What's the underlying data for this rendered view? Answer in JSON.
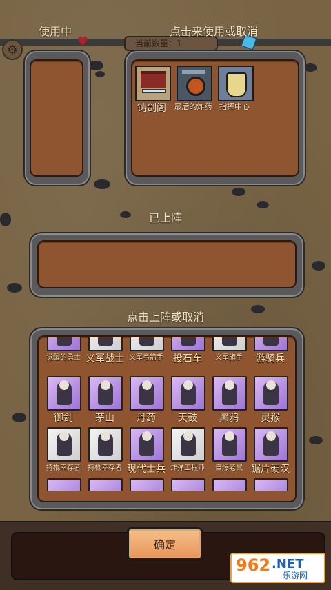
{
  "header": {
    "in_use_label": "使用中",
    "click_use_label": "点击来使用或取消",
    "tab_text": "当前数量：1"
  },
  "buildings": [
    {
      "name": "铸剑阁",
      "icon": "forge-icon",
      "color": "#b9a37a"
    },
    {
      "name": "最后的炸药",
      "icon": "bomb-icon",
      "color": "#4a5662"
    },
    {
      "name": "指挥中心",
      "icon": "command-emblem-icon",
      "color": "#6f7f9a"
    }
  ],
  "deployed_label": "已上阵",
  "units_label": "点击上阵或取消",
  "units": [
    {
      "name": "觉醒的勇士",
      "bg": "purple",
      "small": true
    },
    {
      "name": "义军战士",
      "bg": "white",
      "small": false
    },
    {
      "name": "义军弓箭手",
      "bg": "white",
      "small": true
    },
    {
      "name": "投石车",
      "bg": "purple",
      "small": false
    },
    {
      "name": "义军旗手",
      "bg": "white",
      "small": true
    },
    {
      "name": "游骑兵",
      "bg": "purple",
      "small": false
    },
    {
      "name": "御剑",
      "bg": "purple",
      "small": false
    },
    {
      "name": "茅山",
      "bg": "purple",
      "small": false
    },
    {
      "name": "丹药",
      "bg": "purple",
      "small": false
    },
    {
      "name": "天鼓",
      "bg": "purple",
      "small": false
    },
    {
      "name": "黑鸦",
      "bg": "purple",
      "small": false
    },
    {
      "name": "灵猴",
      "bg": "purple",
      "small": false
    },
    {
      "name": "持棍幸存者",
      "bg": "white",
      "small": true
    },
    {
      "name": "持枪幸存者",
      "bg": "white",
      "small": true
    },
    {
      "name": "现代士兵",
      "bg": "purple",
      "small": false
    },
    {
      "name": "炸弹工程师",
      "bg": "white",
      "small": true
    },
    {
      "name": "自爆老鼠",
      "bg": "purple",
      "small": true
    },
    {
      "name": "锯片硬汉",
      "bg": "purple",
      "small": false
    }
  ],
  "confirm_label": "确定",
  "watermark": {
    "logo": "962",
    "net": ".NET",
    "site": "乐游网"
  }
}
